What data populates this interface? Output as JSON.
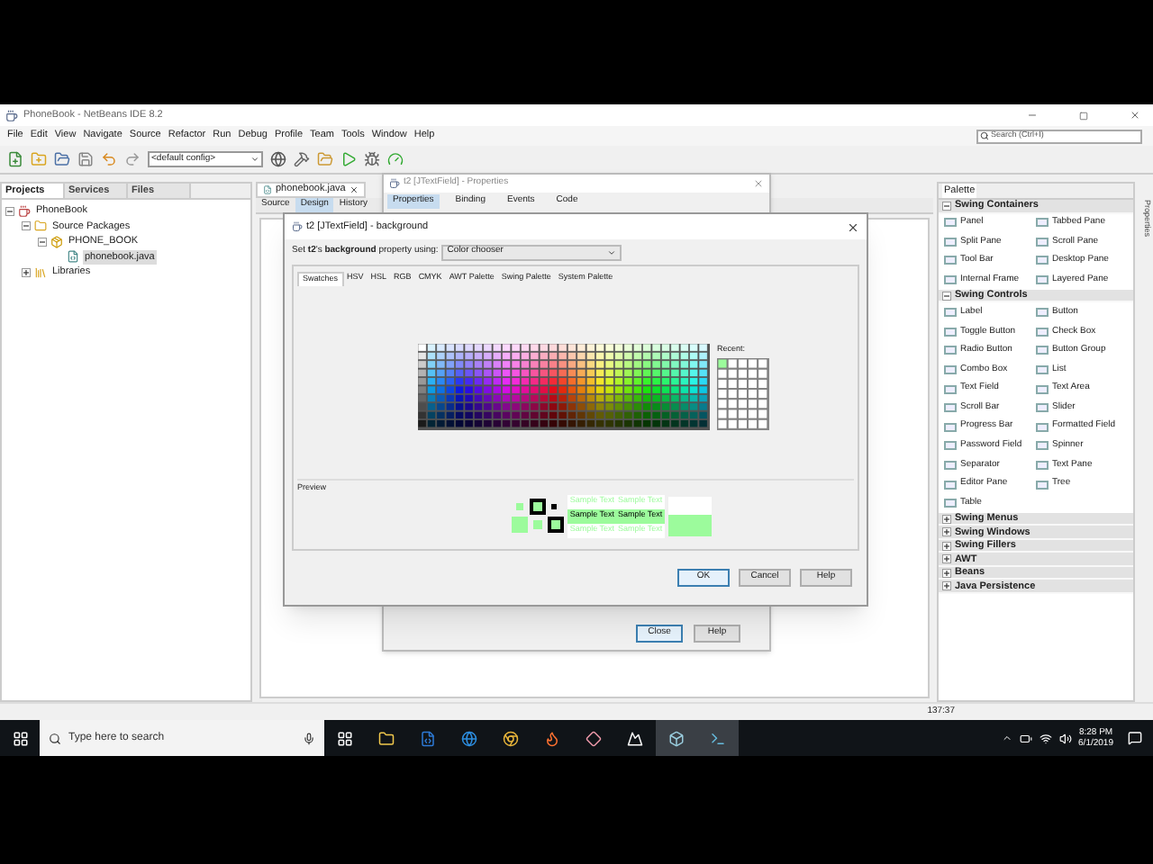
{
  "window": {
    "title": "PhoneBook - NetBeans IDE 8.2"
  },
  "menu": [
    "File",
    "Edit",
    "View",
    "Navigate",
    "Source",
    "Refactor",
    "Run",
    "Debug",
    "Profile",
    "Team",
    "Tools",
    "Window",
    "Help"
  ],
  "toolbar": {
    "config": "<default config>"
  },
  "search": {
    "placeholder": "Search (Ctrl+I)"
  },
  "projects_panel": {
    "tabs": [
      {
        "label": "Projects",
        "selected": true
      },
      {
        "label": "Services",
        "selected": false
      },
      {
        "label": "Files",
        "selected": false
      }
    ],
    "tree": [
      {
        "label": "PhoneBook",
        "kind": "project",
        "expanded": true,
        "children": [
          {
            "label": "Source Packages",
            "kind": "folder",
            "expanded": true,
            "children": [
              {
                "label": "PHONE_BOOK",
                "kind": "package",
                "expanded": true,
                "children": [
                  {
                    "label": "phonebook.java",
                    "kind": "file",
                    "selected": true
                  }
                ]
              }
            ]
          },
          {
            "label": "Libraries",
            "kind": "folder",
            "expanded": false
          }
        ]
      }
    ]
  },
  "editor": {
    "file_tab": "phonebook.java",
    "views": [
      {
        "label": "Source",
        "selected": false
      },
      {
        "label": "Design",
        "selected": true
      },
      {
        "label": "History",
        "selected": false
      }
    ]
  },
  "properties_dialog": {
    "title": "t2 [JTextField] - Properties",
    "tabs": [
      {
        "label": "Properties",
        "selected": true
      },
      {
        "label": "Binding",
        "selected": false
      },
      {
        "label": "Events",
        "selected": false
      },
      {
        "label": "Code",
        "selected": false
      }
    ],
    "buttons": [
      {
        "label": "Close",
        "default": true
      },
      {
        "label": "Help",
        "default": false
      }
    ]
  },
  "color_dialog": {
    "title": "t2 [JTextField] - background",
    "prompt": "Set **t2**'s **background** property using:",
    "editor": "Color chooser",
    "tabs": [
      {
        "label": "Swatches",
        "selected": true
      },
      {
        "label": "HSV",
        "selected": false
      },
      {
        "label": "HSL",
        "selected": false
      },
      {
        "label": "RGB",
        "selected": false
      },
      {
        "label": "CMYK",
        "selected": false
      },
      {
        "label": "AWT Palette",
        "selected": false
      },
      {
        "label": "Swing Palette",
        "selected": false
      },
      {
        "label": "System Palette",
        "selected": false
      }
    ],
    "recent_label": "Recent:",
    "preview_label": "Preview",
    "sample_rows": [
      [
        "Sample Text",
        "Sample Text"
      ],
      [
        "Sample Text",
        "Sample Text"
      ],
      [
        "Sample Text",
        "Sample Text"
      ]
    ],
    "buttons": [
      {
        "label": "OK",
        "default": true
      },
      {
        "label": "Cancel",
        "default": false
      },
      {
        "label": "Help",
        "default": false
      }
    ]
  },
  "palette": {
    "title": "Palette",
    "categories": [
      {
        "name": "Swing Containers",
        "expanded": true,
        "items": [
          "Panel",
          "Tabbed Pane",
          "Split Pane",
          "Scroll Pane",
          "Tool Bar",
          "Desktop Pane",
          "Internal Frame",
          "Layered Pane"
        ]
      },
      {
        "name": "Swing Controls",
        "expanded": true,
        "items": [
          "Label",
          "Button",
          "Toggle Button",
          "Check Box",
          "Radio Button",
          "Button Group",
          "Combo Box",
          "List",
          "Text Field",
          "Text Area",
          "Scroll Bar",
          "Slider",
          "Progress Bar",
          "Formatted Field",
          "Password Field",
          "Spinner",
          "Separator",
          "Text Pane",
          "Editor Pane",
          "Tree",
          "Table"
        ]
      },
      {
        "name": "Swing Menus",
        "expanded": false
      },
      {
        "name": "Swing Windows",
        "expanded": false
      },
      {
        "name": "Swing Fillers",
        "expanded": false
      },
      {
        "name": "AWT",
        "expanded": false
      },
      {
        "name": "Beans",
        "expanded": false
      },
      {
        "name": "Java Persistence",
        "expanded": false
      }
    ]
  },
  "side_tab": "Properties",
  "status_bar": {
    "position": "137:37"
  },
  "taskbar": {
    "search_placeholder": "Type here to search",
    "time": "8:28 PM",
    "date": "6/1/2019"
  }
}
